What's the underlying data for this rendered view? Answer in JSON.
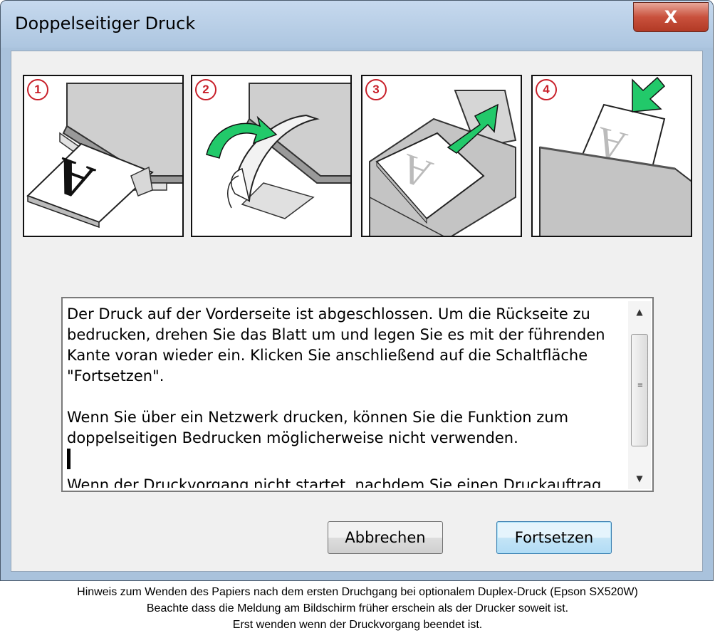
{
  "window": {
    "title": "Doppelseitiger Druck",
    "close_label": "X"
  },
  "steps": [
    {
      "number": "1",
      "icon": "printer-paper-output-icon"
    },
    {
      "number": "2",
      "icon": "flip-paper-icon"
    },
    {
      "number": "3",
      "icon": "reinsert-paper-icon"
    },
    {
      "number": "4",
      "icon": "paper-feed-icon"
    }
  ],
  "message": {
    "paragraphs": [
      "Der Druck auf der Vorderseite ist abgeschlossen. Um die Rückseite zu bedrucken, drehen Sie das Blatt um und legen Sie es mit der führenden Kante voran wieder ein. Klicken Sie anschließend auf die Schaltfläche \"Fortsetzen\".",
      "Wenn Sie über ein Netzwerk drucken, können Sie die Funktion zum doppelseitigen Bedrucken möglicherweise nicht verwenden.",
      "Wenn der Druckvorgang nicht startet, nachdem Sie einen Druckauftrag"
    ]
  },
  "buttons": {
    "cancel": "Abbrechen",
    "continue": "Fortsetzen"
  },
  "caption": {
    "line1": "Hinweis zum Wenden des Papiers nach dem ersten Druchgang bei optionalem Duplex-Druck (Epson SX520W)",
    "line2": "Beachte dass die Meldung am Bildschirm früher erschein als der Drucker soweit ist.",
    "line3": "Erst wenden wenn der Druckvorgang beendet ist."
  },
  "colors": {
    "arrow": "#22c96a",
    "step_number": "#c8202a",
    "close_button": "#c9513d"
  }
}
